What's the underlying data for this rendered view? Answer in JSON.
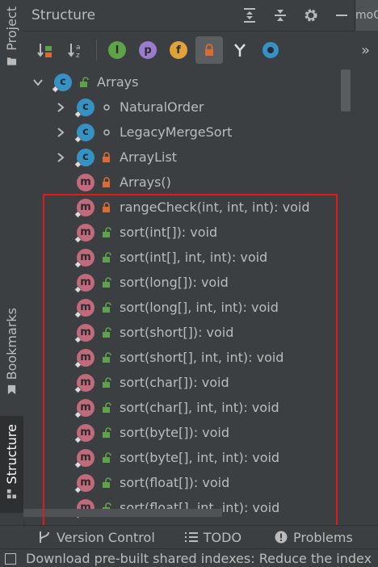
{
  "header": {
    "title": "Structure",
    "editor_tab_text": "moO"
  },
  "left_stripe": {
    "project": "Project",
    "bookmarks": "Bookmarks",
    "structure": "Structure"
  },
  "toolbar": {
    "buttons": [
      {
        "icon": "sort-by-visibility-icon"
      },
      {
        "icon": "sort-alphabetically-icon"
      },
      {
        "icon": "show-inherited-icon"
      },
      {
        "icon": "show-properties-icon",
        "letter": "p"
      },
      {
        "icon": "show-fields-icon",
        "letter": "f"
      },
      {
        "icon": "show-non-public-icon",
        "active": true
      },
      {
        "icon": "show-lambdas-icon"
      },
      {
        "icon": "show-anonymous-icon"
      }
    ]
  },
  "tree": {
    "root": {
      "label": "Arrays",
      "kind": "class",
      "visibility": "public",
      "expanded": true
    },
    "children": [
      {
        "label": "NaturalOrder",
        "kind": "class",
        "visibility": "package",
        "expandable": true
      },
      {
        "label": "LegacyMergeSort",
        "kind": "class",
        "visibility": "package",
        "expandable": true
      },
      {
        "label": "ArrayList",
        "kind": "class",
        "visibility": "private",
        "expandable": true
      },
      {
        "label": "Arrays()",
        "kind": "method",
        "visibility": "private"
      },
      {
        "label": "rangeCheck(int, int, int): void",
        "kind": "method",
        "visibility": "private",
        "static": true
      },
      {
        "label": "sort(int[]): void",
        "kind": "method",
        "visibility": "public",
        "static": true
      },
      {
        "label": "sort(int[], int, int): void",
        "kind": "method",
        "visibility": "public",
        "static": true
      },
      {
        "label": "sort(long[]): void",
        "kind": "method",
        "visibility": "public",
        "static": true
      },
      {
        "label": "sort(long[], int, int): void",
        "kind": "method",
        "visibility": "public",
        "static": true
      },
      {
        "label": "sort(short[]): void",
        "kind": "method",
        "visibility": "public",
        "static": true
      },
      {
        "label": "sort(short[], int, int): void",
        "kind": "method",
        "visibility": "public",
        "static": true
      },
      {
        "label": "sort(char[]): void",
        "kind": "method",
        "visibility": "public",
        "static": true
      },
      {
        "label": "sort(char[], int, int): void",
        "kind": "method",
        "visibility": "public",
        "static": true
      },
      {
        "label": "sort(byte[]): void",
        "kind": "method",
        "visibility": "public",
        "static": true
      },
      {
        "label": "sort(byte[], int, int): void",
        "kind": "method",
        "visibility": "public",
        "static": true
      },
      {
        "label": "sort(float[]): void",
        "kind": "method",
        "visibility": "public",
        "static": true
      },
      {
        "label": "sort(float[], int, int): void",
        "kind": "method",
        "visibility": "public",
        "static": true
      }
    ]
  },
  "bottom_tools": {
    "version_control": "Version Control",
    "todo": "TODO",
    "problems": "Problems"
  },
  "status_bar": {
    "message": "Download pre-built shared indexes: Reduce the index"
  },
  "colors": {
    "class_bubble": "#3592c4",
    "method_bubble": "#c16a7c",
    "public_lock": "#5ea34a",
    "private_lock": "#d96b33",
    "highlight_box": "#e0191e"
  }
}
